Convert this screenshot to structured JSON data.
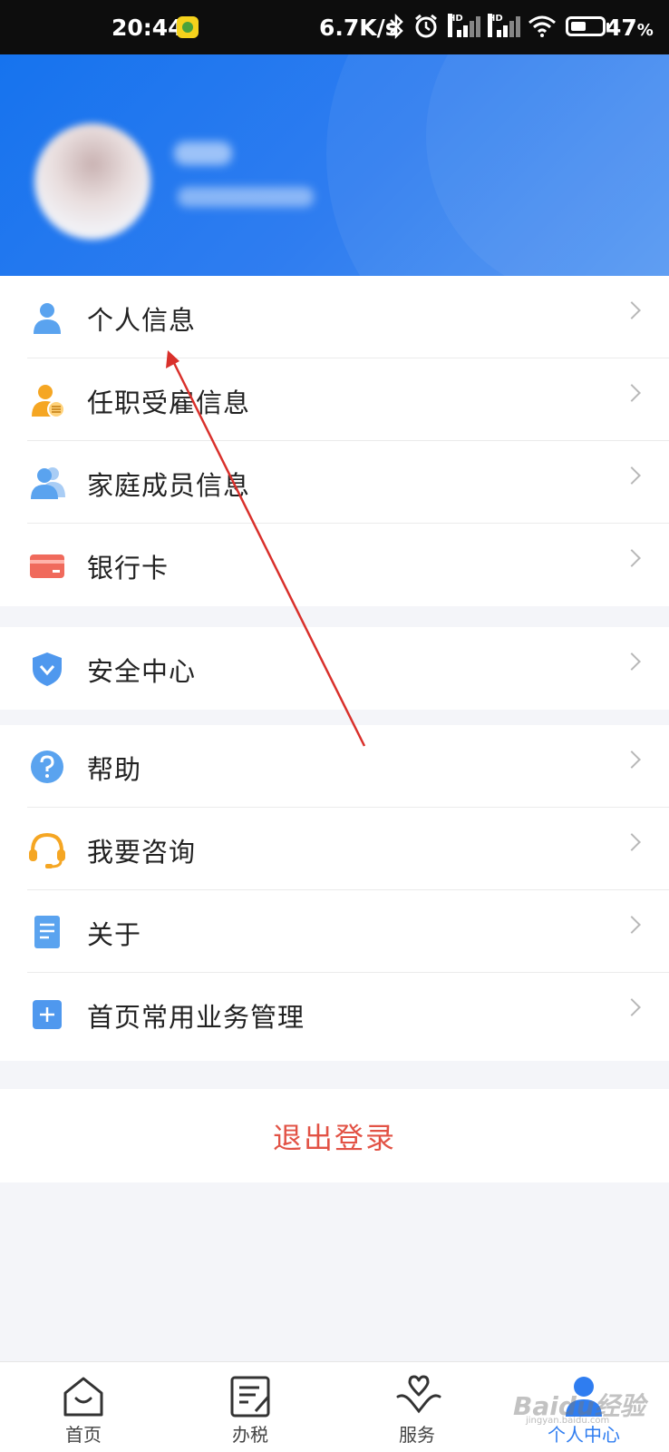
{
  "status_bar": {
    "time": "20:44",
    "network_speed": "6.7K/s",
    "battery_percent": "47",
    "battery_suffix": "%",
    "hd_label": "HD",
    "icons": [
      "bluetooth-icon",
      "alarm-icon",
      "signal-icon",
      "signal-icon",
      "wifi-icon",
      "battery-icon"
    ]
  },
  "menu": {
    "group1": [
      {
        "label": "个人信息",
        "icon": "person-icon"
      },
      {
        "label": "任职受雇信息",
        "icon": "employment-icon"
      },
      {
        "label": "家庭成员信息",
        "icon": "family-icon"
      },
      {
        "label": "银行卡",
        "icon": "bank-card-icon"
      }
    ],
    "group2": [
      {
        "label": "安全中心",
        "icon": "shield-icon"
      }
    ],
    "group3": [
      {
        "label": "帮助",
        "icon": "help-icon"
      },
      {
        "label": "我要咨询",
        "icon": "headset-icon"
      },
      {
        "label": "关于",
        "icon": "document-icon"
      },
      {
        "label": "首页常用业务管理",
        "icon": "plus-icon"
      }
    ]
  },
  "logout_label": "退出登录",
  "tabs": [
    {
      "label": "首页",
      "icon": "home-icon",
      "active": false
    },
    {
      "label": "办税",
      "icon": "tax-icon",
      "active": false
    },
    {
      "label": "服务",
      "icon": "service-icon",
      "active": false
    },
    {
      "label": "个人中心",
      "icon": "profile-icon",
      "active": true
    }
  ],
  "watermark": {
    "text": "Baidu经验",
    "sub": "jingyan.baidu.com"
  },
  "colors": {
    "header_blue": "#2f7df0",
    "logout_red": "#e25245",
    "annotation_red": "#d9302b",
    "active_tab": "#2f7df0"
  }
}
